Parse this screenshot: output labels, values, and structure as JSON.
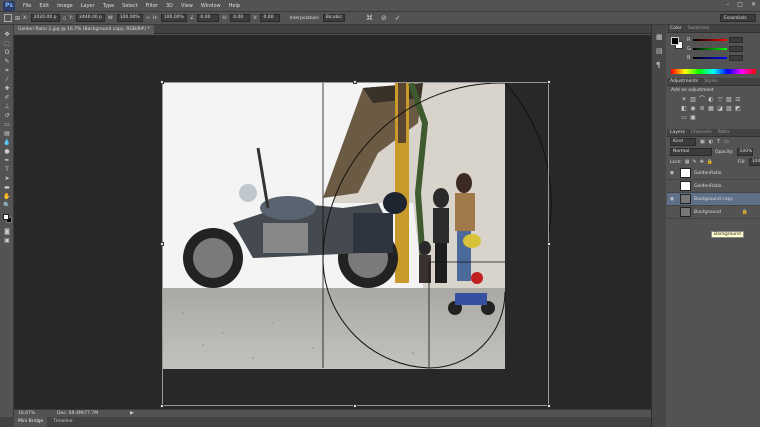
{
  "menubar": {
    "logo": "Ps",
    "items": [
      "File",
      "Edit",
      "Image",
      "Layer",
      "Type",
      "Select",
      "Filter",
      "3D",
      "View",
      "Window",
      "Help"
    ],
    "window_controls": [
      "–",
      "□",
      "✕"
    ]
  },
  "options_bar": {
    "x_label": "X:",
    "x_value": "2020.00 p",
    "y_label": "Y:",
    "y_value": "2440.00 p",
    "w_label": "W:",
    "w_value": "100.00%",
    "h_label": "H:",
    "h_value": "100.00%",
    "angle_value": "0.00",
    "h_skew_label": "H:",
    "h_skew_value": "0.00",
    "v_skew_label": "V:",
    "v_skew_value": "0.00",
    "interpolation_label": "Interpolation:",
    "interpolation_value": "Bicubic",
    "workspace": "Essentials"
  },
  "document": {
    "tab_title": "Golden Ratio 2.jpg @ 16.7% (Background copy, RGB/8#) *",
    "zoom": "16.67%",
    "doc_info": "Doc: 69.4M/77.7M"
  },
  "bottom_tabs": [
    "Mini Bridge",
    "Timeline"
  ],
  "panels": {
    "color_tab": "Color",
    "swatches_tab": "Swatches",
    "slider_labels": [
      "R",
      "G",
      "B"
    ],
    "adjustments_tab": "Adjustments",
    "styles_tab": "Styles",
    "add_adjustment": "Add an adjustment",
    "layers_tab": "Layers",
    "channels_tab": "Channels",
    "paths_tab": "Paths",
    "kind_label": "Kind",
    "blend_mode": "Normal",
    "opacity_label": "Opacity:",
    "opacity_value": "100%",
    "lock_label": "Lock:",
    "fill_label": "Fill:",
    "fill_value": "100%",
    "layers": [
      {
        "name": "GoldenRatio",
        "visible": true,
        "selected": false
      },
      {
        "name": "GoldenRatio",
        "visible": false,
        "selected": false
      },
      {
        "name": "Background copy",
        "visible": true,
        "selected": true
      },
      {
        "name": "Background",
        "visible": false,
        "selected": false,
        "locked": true
      }
    ],
    "tooltip": "Background"
  },
  "colors": {
    "accent_selected": "#5f6f88",
    "ui_gray": "#535353",
    "canvas_bg": "#282828"
  }
}
